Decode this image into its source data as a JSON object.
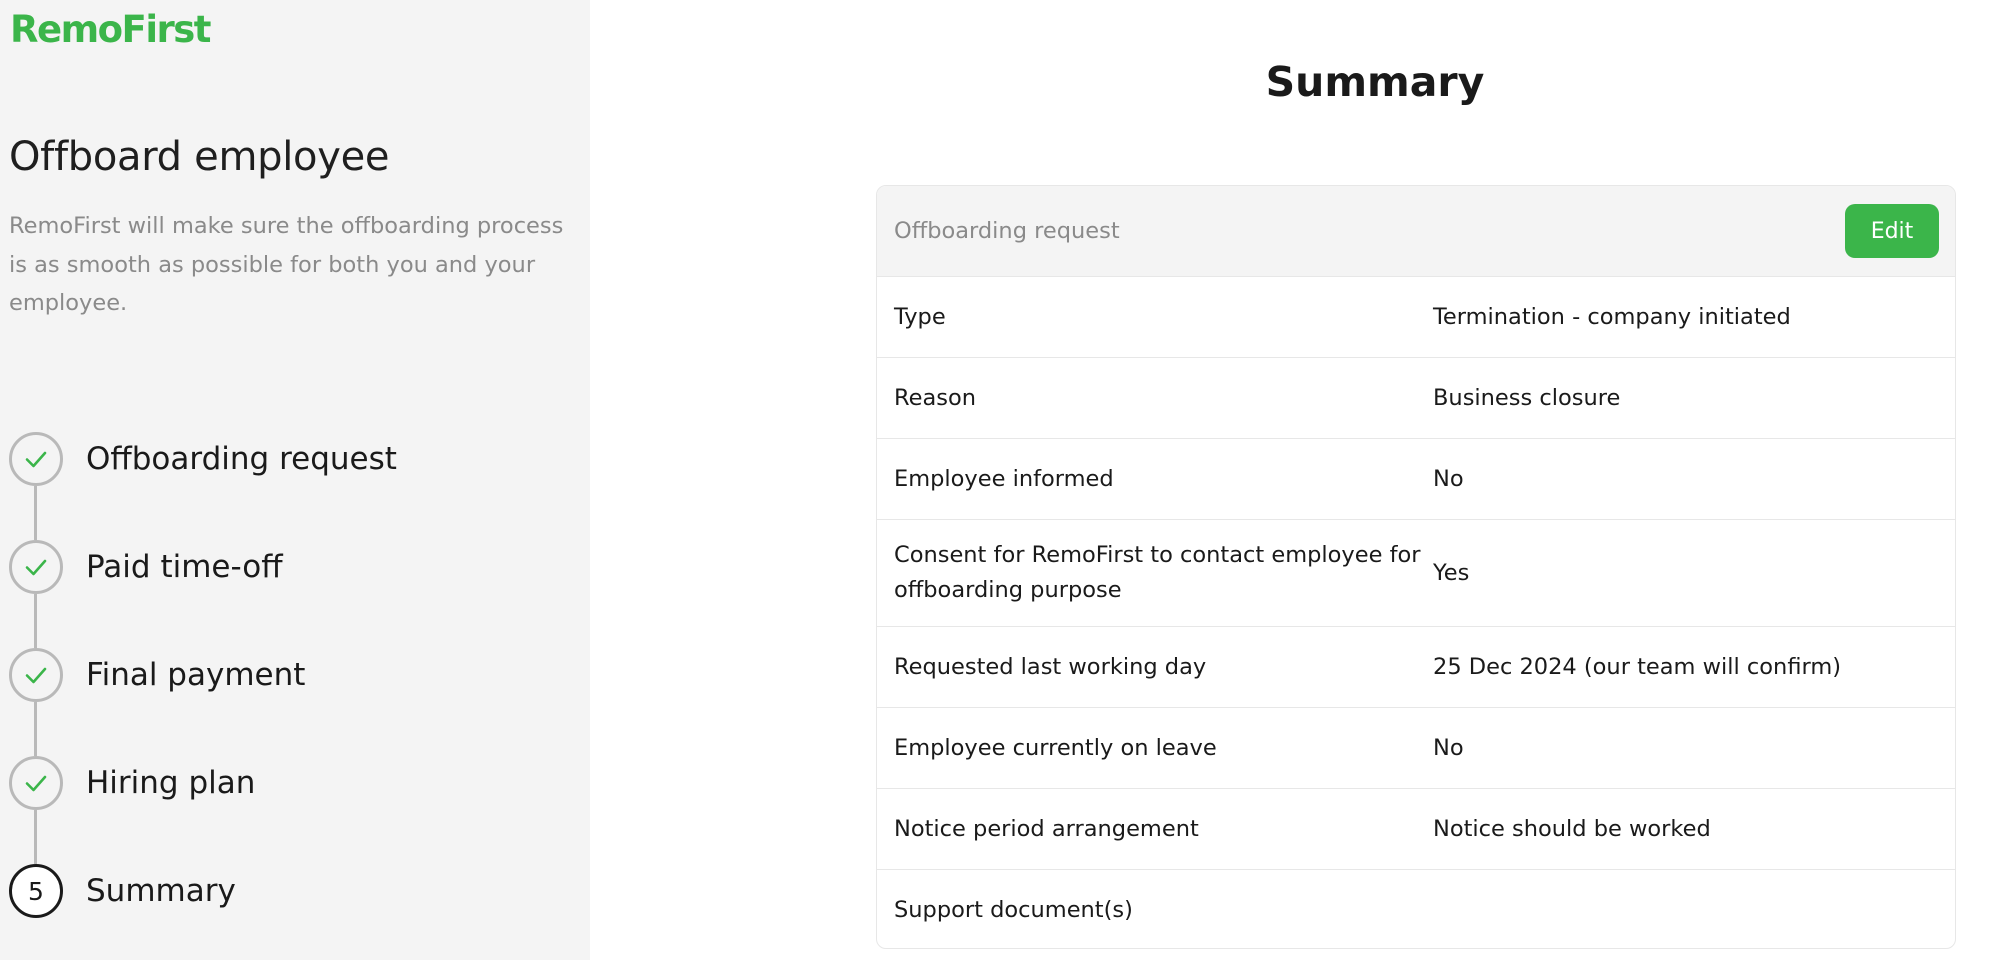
{
  "brand": {
    "logo_text": "RemoFirst",
    "accent_color": "#3bb54a"
  },
  "sidebar": {
    "title": "Offboard employee",
    "description": "RemoFirst will make sure the offboarding process is as smooth as possible for both you and your employee.",
    "steps": [
      {
        "label": "Offboarding request",
        "status": "completed",
        "icon": "check-icon"
      },
      {
        "label": "Paid time-off",
        "status": "completed",
        "icon": "check-icon"
      },
      {
        "label": "Final payment",
        "status": "completed",
        "icon": "check-icon"
      },
      {
        "label": "Hiring plan",
        "status": "completed",
        "icon": "check-icon"
      },
      {
        "label": "Summary",
        "status": "current",
        "number": "5"
      }
    ]
  },
  "main": {
    "title": "Summary",
    "card": {
      "title": "Offboarding request",
      "edit_label": "Edit",
      "rows": [
        {
          "label": "Type",
          "value": "Termination - company initiated"
        },
        {
          "label": "Reason",
          "value": "Business closure"
        },
        {
          "label": "Employee informed",
          "value": "No"
        },
        {
          "label": "Consent for RemoFirst to contact employee for offboarding purpose",
          "value": "Yes"
        },
        {
          "label": "Requested last working day",
          "value": "25 Dec 2024 (our team will confirm)"
        },
        {
          "label": "Employee currently on leave",
          "value": "No"
        },
        {
          "label": "Notice period arrangement",
          "value": "Notice should be worked"
        },
        {
          "label": "Support document(s)",
          "value": ""
        }
      ]
    }
  }
}
